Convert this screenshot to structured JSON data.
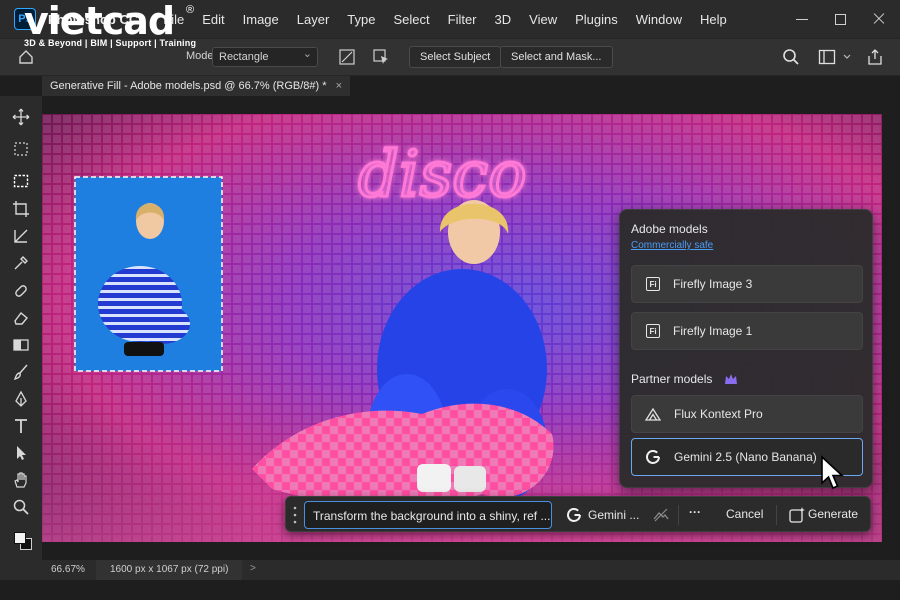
{
  "app": {
    "logo_text": "Ps",
    "name": "Photoshop CC",
    "menu": [
      "File",
      "Edit",
      "Image",
      "Layer",
      "Type",
      "Select",
      "Filter",
      "3D",
      "View",
      "Plugins",
      "Window",
      "Help"
    ]
  },
  "watermark": {
    "logo": "vietcad",
    "registered": "®",
    "tagline": "3D & Beyond | BIM | Support | Training"
  },
  "options_bar": {
    "mode_label": "Mode:",
    "mode_value": "Rectangle",
    "select_subject": "Select Subject",
    "select_and_mask": "Select and Mask..."
  },
  "document": {
    "tab_title": "Generative Fill - Adobe models.psd @ 66.7% (RGB/8#) *",
    "close_glyph": "×",
    "canvas_sign_text": "disco"
  },
  "model_panel": {
    "adobe_heading": "Adobe models",
    "adobe_sub": "Commercially safe",
    "firefly_badge": "Fi",
    "adobe_items": [
      "Firefly Image 3",
      "Firefly Image 1"
    ],
    "partner_heading": "Partner models",
    "partner_items": [
      "Flux Kontext Pro",
      "Gemini 2.5 (Nano Banana)"
    ],
    "selected_item": "Gemini 2.5 (Nano Banana)"
  },
  "task_bar": {
    "prompt_value": "Transform the background into a shiny, ref ...",
    "model_label": "Gemini ...",
    "more_glyph": "···",
    "cancel_label": "Cancel",
    "generate_label": "Generate"
  },
  "status_bar": {
    "zoom": "66.67%",
    "dimensions": "1600 px x 1067 px (72 ppi)",
    "arrow": ">"
  },
  "colors": {
    "accent_blue": "#4b8fe0",
    "panel_bg": "#2c2c2c",
    "chrome_bg": "#2b2b2b",
    "crown_purple": "#8a6cf0"
  }
}
